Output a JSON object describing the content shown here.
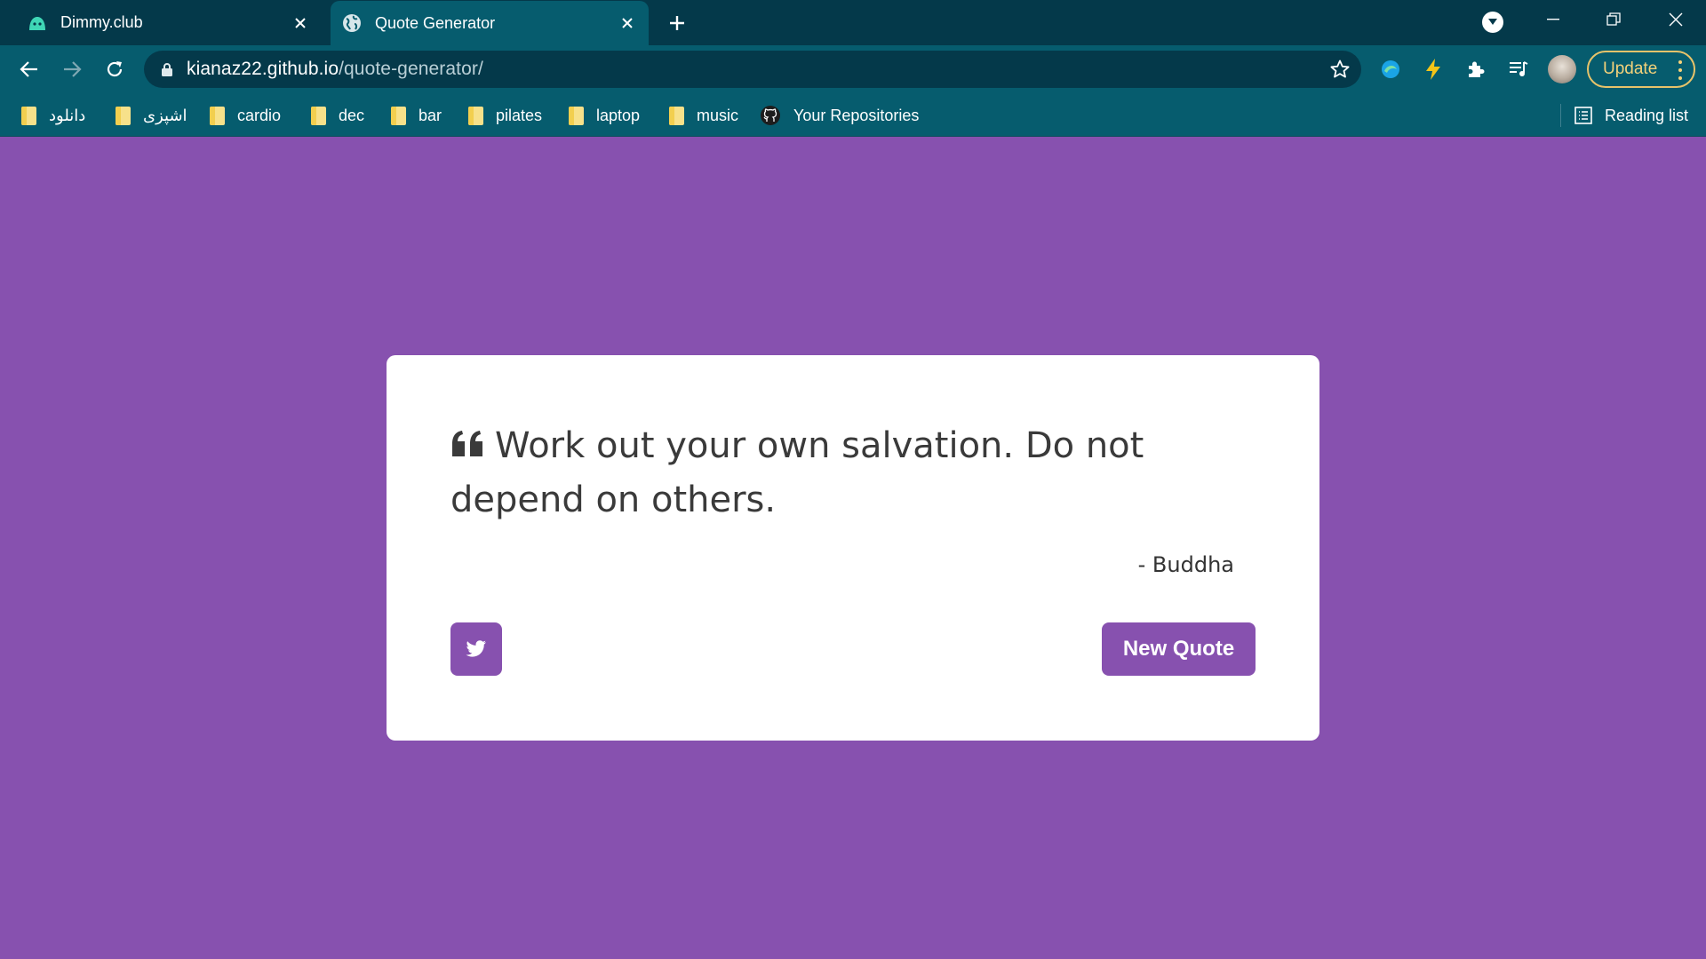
{
  "browser": {
    "tabs": [
      {
        "title": "Dimmy.club",
        "icon": "dimmy-logo-icon",
        "active": false
      },
      {
        "title": "Quote Generator",
        "icon": "globe-icon",
        "active": true
      }
    ],
    "url": {
      "host": "kianaz22.github.io",
      "path": "/quote-generator/"
    },
    "update_label": "Update",
    "bookmarks": [
      {
        "label": "دانلود",
        "icon": "folder-icon"
      },
      {
        "label": "اشپزی",
        "icon": "folder-icon"
      },
      {
        "label": "cardio",
        "icon": "folder-icon"
      },
      {
        "label": "dec",
        "icon": "folder-icon"
      },
      {
        "label": "bar",
        "icon": "folder-icon"
      },
      {
        "label": "pilates",
        "icon": "folder-icon"
      },
      {
        "label": "laptop",
        "icon": "folder-icon"
      },
      {
        "label": "music",
        "icon": "folder-icon"
      },
      {
        "label": "Your Repositories",
        "icon": "github-icon"
      }
    ],
    "reading_list_label": "Reading list"
  },
  "page": {
    "background_color": "#8751af",
    "quote": {
      "text": "Work out your own salvation. Do not depend on others.",
      "author": "- Buddha"
    },
    "new_quote_label": "New Quote",
    "accent_color": "#8751af"
  }
}
